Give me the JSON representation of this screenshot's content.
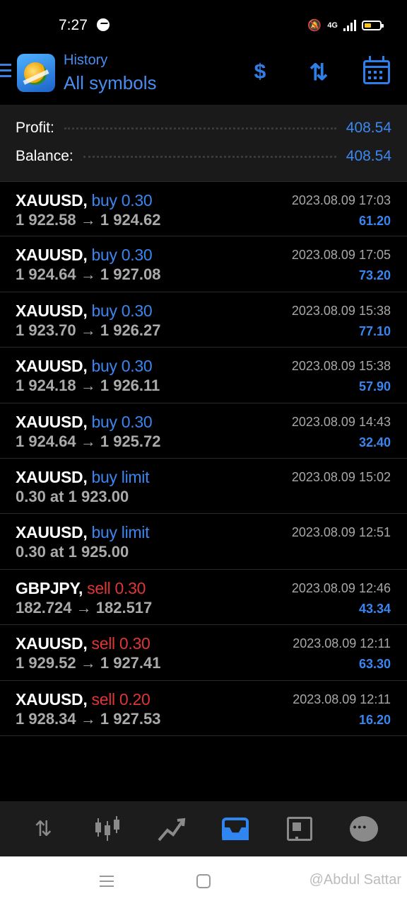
{
  "status_bar": {
    "time": "7:27",
    "network": "4G"
  },
  "header": {
    "subtitle": "History",
    "title": "All symbols"
  },
  "summary": {
    "profit_label": "Profit:",
    "profit_value": "408.54",
    "balance_label": "Balance:",
    "balance_value": "408.54"
  },
  "trades": [
    {
      "symbol": "XAUUSD,",
      "type": "buy 0.30",
      "side": "buy",
      "prices": "1 922.58 → 1 924.62",
      "date": "2023.08.09 17:03",
      "profit": "61.20"
    },
    {
      "symbol": "XAUUSD,",
      "type": "buy 0.30",
      "side": "buy",
      "prices": "1 924.64 → 1 927.08",
      "date": "2023.08.09 17:05",
      "profit": "73.20"
    },
    {
      "symbol": "XAUUSD,",
      "type": "buy 0.30",
      "side": "buy",
      "prices": "1 923.70 → 1 926.27",
      "date": "2023.08.09 15:38",
      "profit": "77.10"
    },
    {
      "symbol": "XAUUSD,",
      "type": "buy 0.30",
      "side": "buy",
      "prices": "1 924.18 → 1 926.11",
      "date": "2023.08.09 15:38",
      "profit": "57.90"
    },
    {
      "symbol": "XAUUSD,",
      "type": "buy 0.30",
      "side": "buy",
      "prices": "1 924.64 → 1 925.72",
      "date": "2023.08.09 14:43",
      "profit": "32.40"
    },
    {
      "symbol": "XAUUSD,",
      "type": "buy limit",
      "side": "buy",
      "prices": "0.30 at 1 923.00",
      "date": "2023.08.09 15:02",
      "profit": ""
    },
    {
      "symbol": "XAUUSD,",
      "type": "buy limit",
      "side": "buy",
      "prices": "0.30 at 1 925.00",
      "date": "2023.08.09 12:51",
      "profit": ""
    },
    {
      "symbol": "GBPJPY,",
      "type": "sell 0.30",
      "side": "sell",
      "prices": "182.724 → 182.517",
      "date": "2023.08.09 12:46",
      "profit": "43.34"
    },
    {
      "symbol": "XAUUSD,",
      "type": "sell 0.30",
      "side": "sell",
      "prices": "1 929.52 → 1 927.41",
      "date": "2023.08.09 12:11",
      "profit": "63.30"
    },
    {
      "symbol": "XAUUSD,",
      "type": "sell 0.20",
      "side": "sell",
      "prices": "1 928.34 → 1 927.53",
      "date": "2023.08.09 12:11",
      "profit": "16.20"
    }
  ],
  "bottom_nav": {
    "items": [
      "quotes-icon",
      "chart-icon",
      "trade-icon",
      "history-icon",
      "news-icon",
      "chat-icon"
    ],
    "active": "history-icon"
  },
  "watermark": "@Abdul Sattar",
  "colors": {
    "accent": "#3a86f0",
    "sell": "#e03535",
    "background": "#000000",
    "summary_bg": "#1a1a1a"
  }
}
